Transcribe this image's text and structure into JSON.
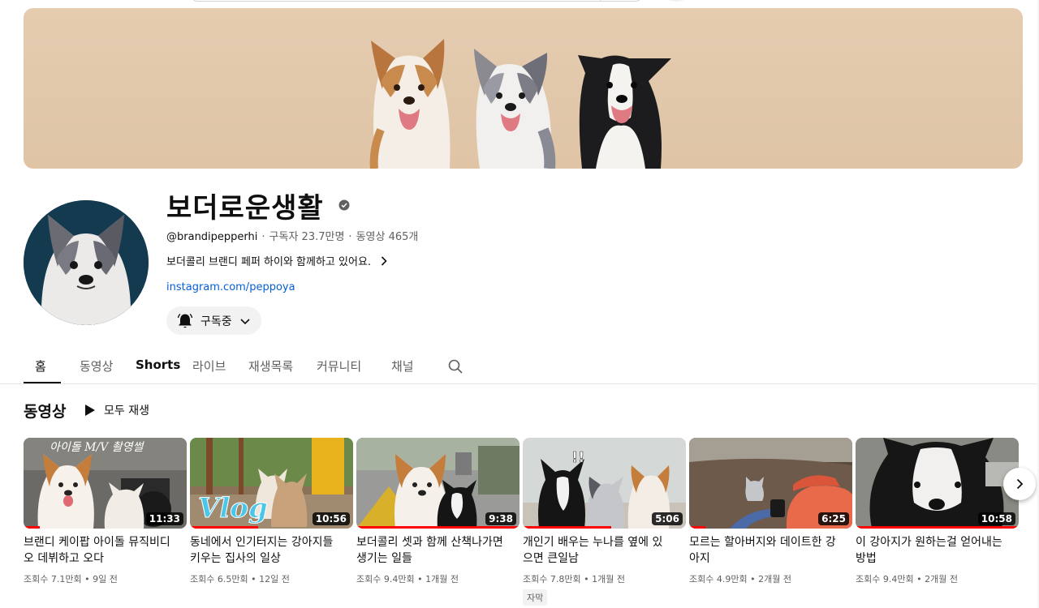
{
  "channel": {
    "name": "보더로운생활",
    "handle": "@brandipepperhi",
    "subscribers": "구독자 23.7만명",
    "video_count": "동영상 465개",
    "description": "보더콜리 브랜디 페퍼 하이와 함께하고 있어요.",
    "link": "instagram.com/peppoya",
    "subscribe_label": "구독중"
  },
  "tabs": [
    {
      "label": "홈",
      "active": true
    },
    {
      "label": "동영상"
    },
    {
      "label": "Shorts"
    },
    {
      "label": "라이브"
    },
    {
      "label": "재생목록"
    },
    {
      "label": "커뮤니티"
    },
    {
      "label": "채널"
    }
  ],
  "section": {
    "title": "동영상",
    "play_all": "모두 재생"
  },
  "videos": [
    {
      "title": "브랜디 케이팝 아이돌 뮤직비디오 데뷔하고 오다",
      "duration": "11:33",
      "views": "조회수 7.1만회",
      "age": "9일 전",
      "progress": 0.1,
      "overlay_text": "아이돌 M/V 촬영썰"
    },
    {
      "title": "동네에서 인기터지는 강아지들 키우는 집사의 일상",
      "duration": "10:56",
      "views": "조회수 6.5만회",
      "age": "12일 전",
      "progress": 0.42,
      "overlay_text": "Vlog"
    },
    {
      "title": "보더콜리 셋과 함께 산책나가면 생기는 일들",
      "duration": "9:38",
      "views": "조회수 9.4만회",
      "age": "1개월 전",
      "progress": 1.0
    },
    {
      "title": "개인기 배우는 누나를 옆에 있으면 큰일남",
      "duration": "5:06",
      "views": "조회수 7.8만회",
      "age": "1개월 전",
      "progress": 0.54,
      "badge": "자막",
      "overlay_text": "!!"
    },
    {
      "title": "모르는 할아버지와 데이트한 강아지",
      "duration": "6:25",
      "views": "조회수 4.9만회",
      "age": "2개월 전",
      "progress": 0.1
    },
    {
      "title": "이 강아지가 원하는걸 얻어내는 방법",
      "duration": "10:58",
      "views": "조회수 9.4만회",
      "age": "2개월 전",
      "progress": 1.0
    }
  ],
  "icons": {
    "verified": "verified-check-icon",
    "chevron": "chevron-right-icon",
    "bell": "bell-icon",
    "search": "search-icon",
    "play": "play-icon"
  },
  "colors": {
    "accent_red": "#ff0000",
    "link_blue": "#065fd4",
    "banner_bg": "#e3c9ab"
  }
}
